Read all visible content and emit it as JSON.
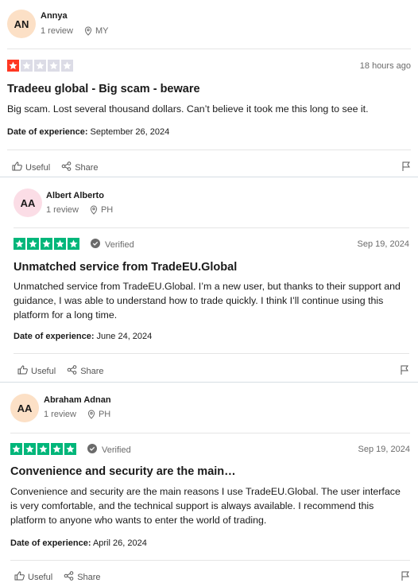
{
  "colors": {
    "green": "#00b67a",
    "red": "#ff3722",
    "grey_star": "#dcdce6"
  },
  "common": {
    "useful_label": "Useful",
    "share_label": "Share",
    "verified_label": "Verified",
    "date_label": "Date of experience:"
  },
  "reviews": [
    {
      "initials": "AN",
      "avatar_color": "#fce0c6",
      "name": "Annya",
      "review_count": "1 review",
      "country": "MY",
      "rating": 1,
      "verified": false,
      "date": "18 hours ago",
      "title": "Tradeeu global - Big scam - beware",
      "body": "Big scam. Lost several thousand dollars. Can’t believe it took me this long to see it.",
      "experience_date": "September 26, 2024"
    },
    {
      "initials": "AA",
      "avatar_color": "#fbdde6",
      "name": "Albert Alberto",
      "review_count": "1 review",
      "country": "PH",
      "rating": 5,
      "verified": true,
      "date": "Sep 19, 2024",
      "title": "Unmatched service from TradeEU.Global",
      "body": "Unmatched service from TradeEU.Global. I’m a new user, but thanks to their support and guidance, I was able to understand how to trade quickly. I think I’ll continue using this platform for a long time.",
      "experience_date": "June 24, 2024"
    },
    {
      "initials": "AA",
      "avatar_color": "#fce0c6",
      "name": "Abraham Adnan",
      "review_count": "1 review",
      "country": "PH",
      "rating": 5,
      "verified": true,
      "date": "Sep 19, 2024",
      "title": "Convenience and security are the main…",
      "body": "Convenience and security are the main reasons I use TradeEU.Global. The user interface is very comfortable, and the technical support is always available. I recommend this platform to anyone who wants to enter the world of trading.",
      "experience_date": "April 26, 2024"
    }
  ]
}
